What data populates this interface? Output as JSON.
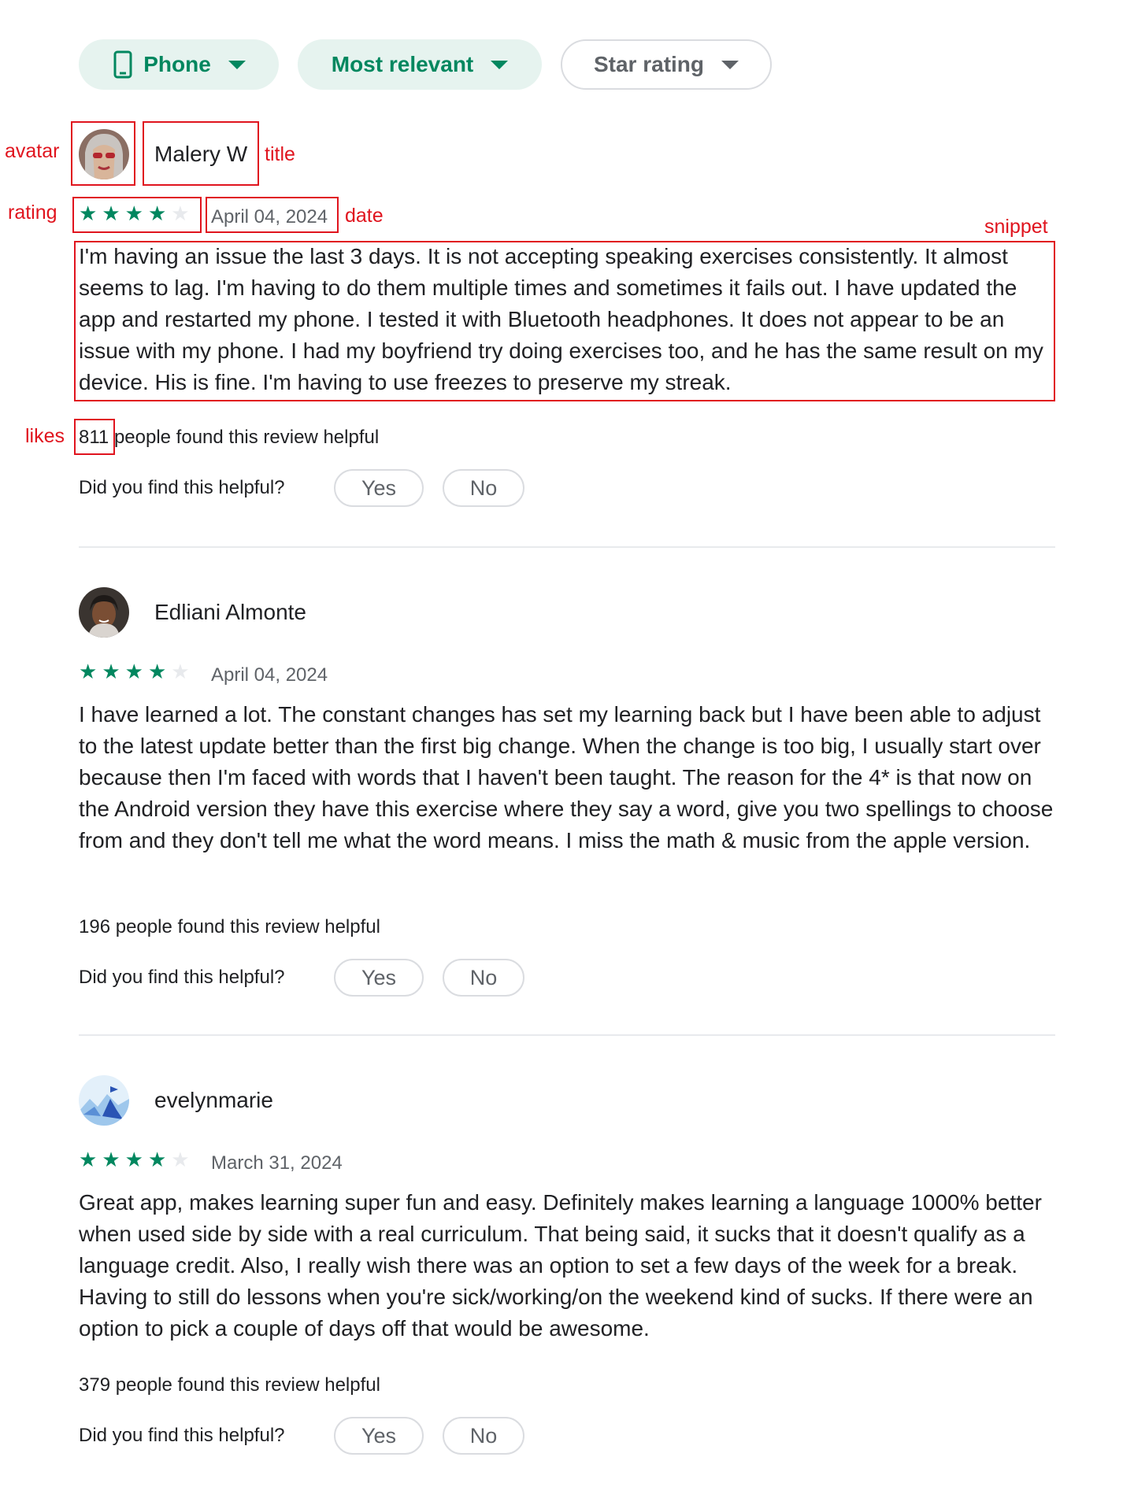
{
  "filters": [
    {
      "label": "Phone",
      "icon": "phone-icon",
      "selected": true
    },
    {
      "label": "Most relevant",
      "selected": true
    },
    {
      "label": "Star rating",
      "selected": false
    }
  ],
  "reviews": [
    {
      "author": "Malery W",
      "rating": 4,
      "date": "April 04, 2024",
      "snippet": "I'm having an issue the last 3 days. It is not accepting speaking exercises consistently. It almost seems to lag. I'm having to do them multiple times and sometimes it fails out. I have updated the app and restarted my phone. I tested it with Bluetooth headphones. It does not appear to be an issue with my phone. I had my boyfriend try doing exercises too, and he has the same result on my device. His is fine. I'm having to use freezes to preserve my streak.",
      "likes": "811",
      "helpful_suffix": "people found this review helpful"
    },
    {
      "author": "Edliani Almonte",
      "rating": 4,
      "date": "April 04, 2024",
      "snippet": "I have learned a lot. The constant changes has set my learning back but I have been able to adjust to the latest update better than the first big change. When the change is too big, I usually start over because then I'm faced with words that I haven't been taught. The reason for the 4* is that now on the Android version they have this exercise where they say a word, give you two spellings to choose from and they don't tell me what the word means. I miss the math & music from the apple version.",
      "likes": "196",
      "helpful_suffix": "people found this review helpful"
    },
    {
      "author": "evelynmarie",
      "rating": 4,
      "date": "March 31, 2024",
      "snippet": "Great app, makes learning super fun and easy. Definitely makes learning a language 1000% better when used side by side with a real curriculum. That being said, it sucks that it doesn't qualify as a language credit. Also, I really wish there was an option to set a few days of the week for a break. Having to still do lessons when you're sick/working/on the weekend kind of sucks. If there were an option to pick a couple of days off that would be awesome.",
      "likes": "379",
      "helpful_suffix": "people found this review helpful"
    }
  ],
  "helpful_prompt": "Did you find this helpful?",
  "vote_yes": "Yes",
  "vote_no": "No",
  "annotations": {
    "avatar": "avatar",
    "title": "title",
    "rating": "rating",
    "date": "date",
    "snippet": "snippet",
    "likes": "likes"
  },
  "colors": {
    "accent": "#01875f",
    "chip_selected_bg": "#e6f3ef",
    "annotation": "#e0141e",
    "star_off": "#e8eaed"
  }
}
